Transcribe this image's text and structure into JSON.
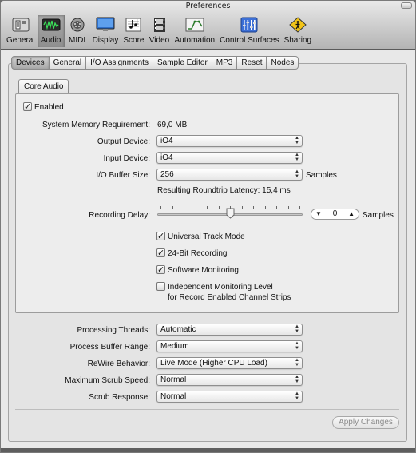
{
  "window": {
    "title": "Preferences"
  },
  "toolbar": [
    {
      "label": "General",
      "icon": "switch-panel-icon",
      "selected": false
    },
    {
      "label": "Audio",
      "icon": "audio-waveform-icon",
      "selected": true
    },
    {
      "label": "MIDI",
      "icon": "midi-connector-icon",
      "selected": false
    },
    {
      "label": "Display",
      "icon": "monitor-icon",
      "selected": false
    },
    {
      "label": "Score",
      "icon": "score-notes-icon",
      "selected": false
    },
    {
      "label": "Video",
      "icon": "film-strip-icon",
      "selected": false
    },
    {
      "label": "Automation",
      "icon": "automation-curve-icon",
      "selected": false
    },
    {
      "label": "Control Surfaces",
      "icon": "control-surface-icon",
      "selected": false
    },
    {
      "label": "Sharing",
      "icon": "sharing-sign-icon",
      "selected": false
    }
  ],
  "tabs": [
    "Devices",
    "General",
    "I/O Assignments",
    "Sample Editor",
    "MP3",
    "Reset",
    "Nodes"
  ],
  "selected_tab": "Devices",
  "subtab": "Core Audio",
  "enabled": {
    "label": "Enabled",
    "checked": true
  },
  "system_memory": {
    "label": "System Memory Requirement:",
    "value": "69,0 MB"
  },
  "output_device": {
    "label": "Output Device:",
    "value": "iO4"
  },
  "input_device": {
    "label": "Input Device:",
    "value": "iO4"
  },
  "buffer_size": {
    "label": "I/O Buffer Size:",
    "value": "256",
    "unit": "Samples"
  },
  "latency_text": "Resulting Roundtrip Latency: 15,4 ms",
  "recording_delay": {
    "label": "Recording Delay:",
    "value": "0",
    "unit": "Samples",
    "slider_fraction": 0.5
  },
  "checkboxes": [
    {
      "label": "Universal Track Mode",
      "checked": true
    },
    {
      "label": "24-Bit Recording",
      "checked": true
    },
    {
      "label": "Software Monitoring",
      "checked": true
    },
    {
      "label": "Independent Monitoring Level",
      "sublabel": "for Record Enabled Channel Strips",
      "checked": false
    }
  ],
  "processing_threads": {
    "label": "Processing Threads:",
    "value": "Automatic"
  },
  "process_buffer_range": {
    "label": "Process Buffer Range:",
    "value": "Medium"
  },
  "rewire_behavior": {
    "label": "ReWire Behavior:",
    "value": "Live Mode (Higher CPU Load)"
  },
  "max_scrub_speed": {
    "label": "Maximum Scrub Speed:",
    "value": "Normal"
  },
  "scrub_response": {
    "label": "Scrub Response:",
    "value": "Normal"
  },
  "apply_button": "Apply Changes",
  "colors": {
    "accent": "#3a6fd8",
    "window_bg": "#e8e8e8"
  }
}
